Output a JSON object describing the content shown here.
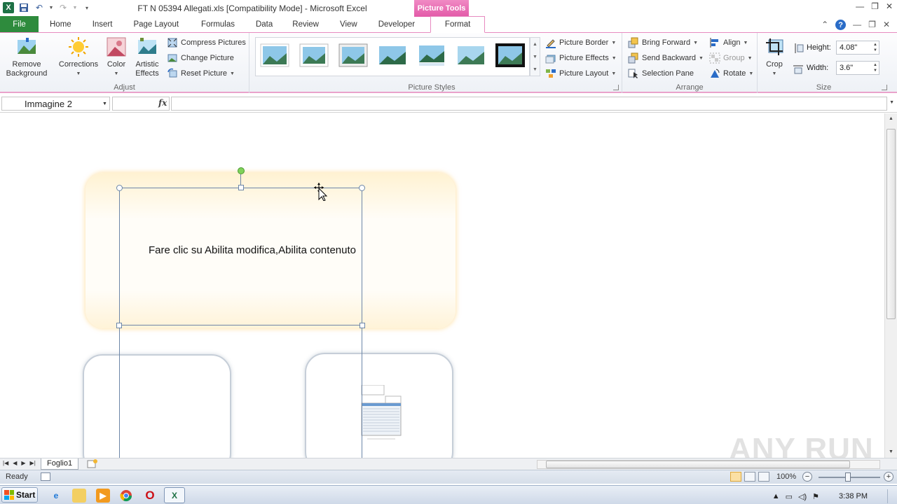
{
  "window": {
    "title": "FT N 05394 Allegati.xls  [Compatibility Mode]  -  Microsoft Excel",
    "context_tab_header": "Picture Tools"
  },
  "tabs": [
    {
      "label": "File"
    },
    {
      "label": "Home"
    },
    {
      "label": "Insert"
    },
    {
      "label": "Page Layout"
    },
    {
      "label": "Formulas"
    },
    {
      "label": "Data"
    },
    {
      "label": "Review"
    },
    {
      "label": "View"
    },
    {
      "label": "Developer"
    },
    {
      "label": "Format"
    }
  ],
  "ribbon": {
    "adjust": {
      "label": "Adjust",
      "remove_background": "Remove Background",
      "corrections": "Corrections",
      "color": "Color",
      "artistic_effects": "Artistic Effects",
      "compress_pictures": "Compress Pictures",
      "change_picture": "Change Picture",
      "reset_picture": "Reset Picture"
    },
    "picture_styles": {
      "label": "Picture Styles",
      "picture_border": "Picture Border",
      "picture_effects": "Picture Effects",
      "picture_layout": "Picture Layout"
    },
    "arrange": {
      "label": "Arrange",
      "bring_forward": "Bring Forward",
      "send_backward": "Send Backward",
      "selection_pane": "Selection Pane",
      "align": "Align",
      "group": "Group",
      "rotate": "Rotate"
    },
    "size": {
      "label": "Size",
      "crop": "Crop",
      "height_label": "Height:",
      "height_value": "4.08\"",
      "width_label": "Width:",
      "width_value": "3.6\""
    }
  },
  "formula_bar": {
    "name_box": "Immagine 2",
    "fx_label": "fx",
    "formula": ""
  },
  "sheet": {
    "callout_text": "Fare clic su Abilita modifica,Abilita contenuto",
    "watermark": "ANY RUN"
  },
  "sheet_tabs": [
    {
      "label": "Foglio1"
    }
  ],
  "status": {
    "ready": "Ready",
    "zoom": "100%"
  },
  "taskbar": {
    "start_label": "Start",
    "clock": "3:38 PM"
  },
  "colors": {
    "file_tab": "#2e8b3d",
    "context_tab": "#e35aa8",
    "selection": "#6c86a8",
    "rotate_handle": "#7fd25a"
  }
}
